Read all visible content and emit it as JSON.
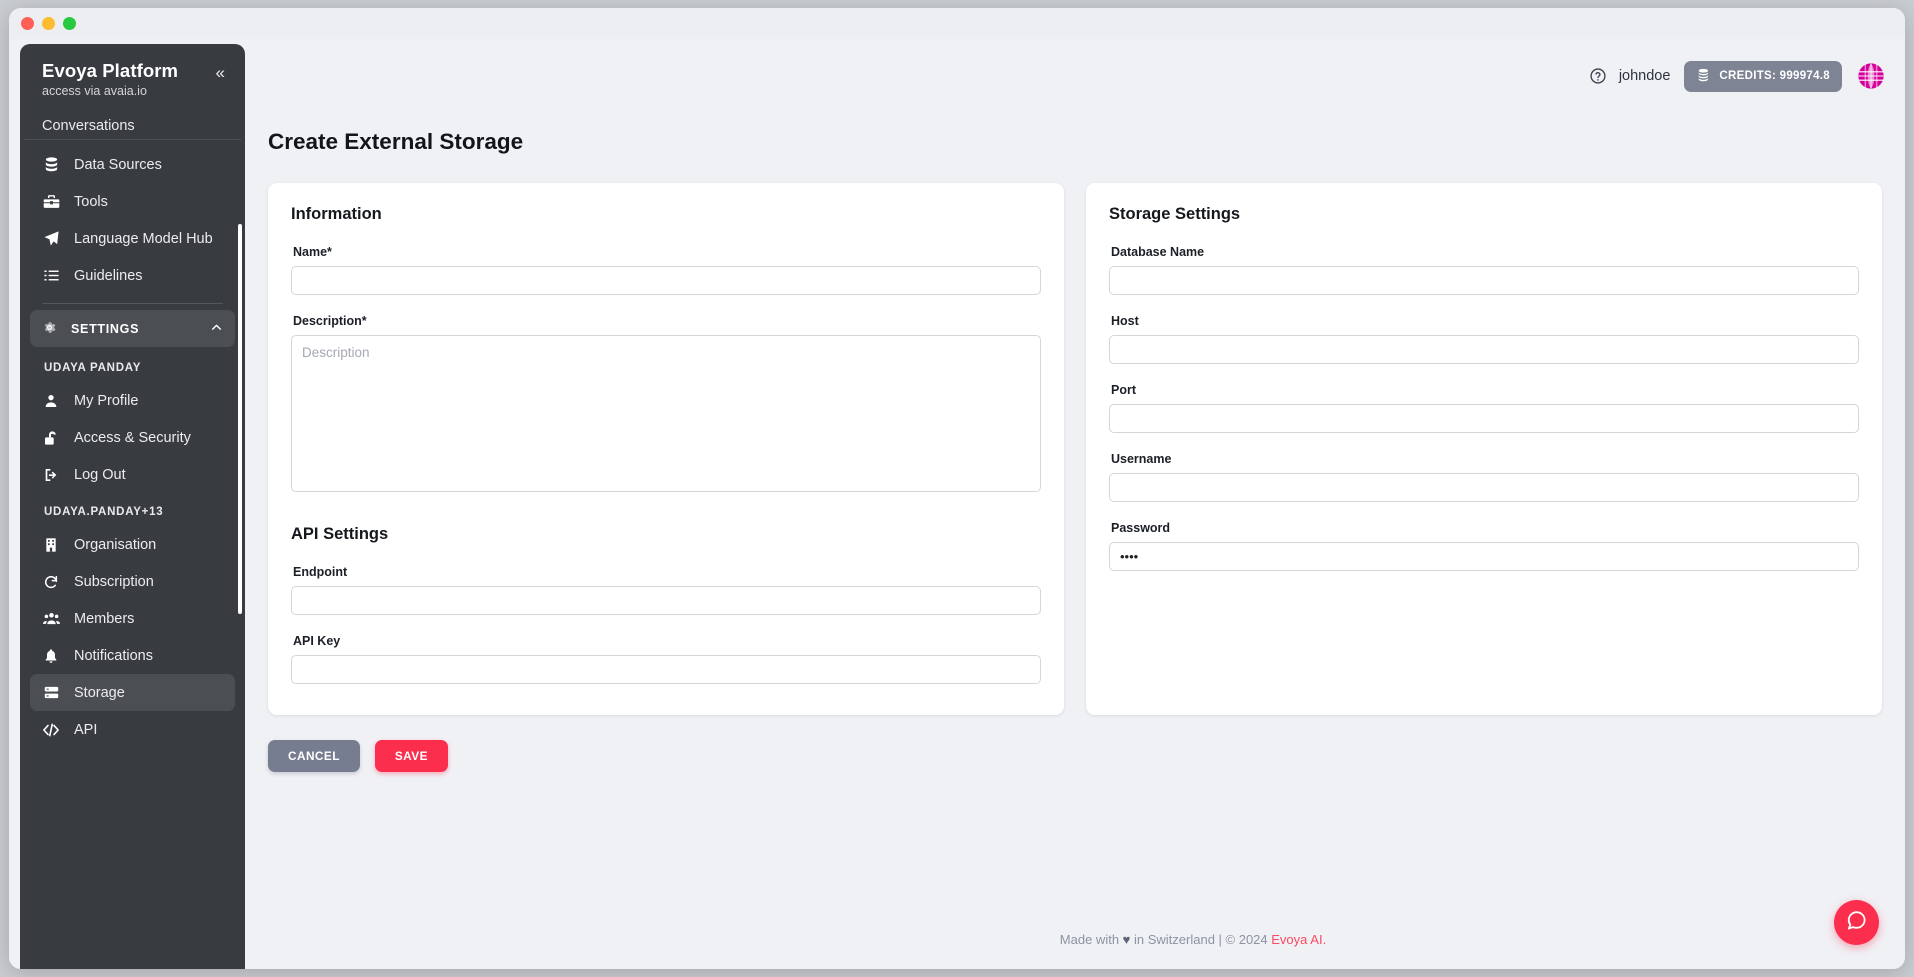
{
  "window": {
    "traffic_lights": [
      "close",
      "minimize",
      "maximize"
    ]
  },
  "sidebar": {
    "title": "Evoya Platform",
    "subtitle": "access via avaia.io",
    "collapse_icon": "chevron-double-left-icon",
    "scrolled_item_partial": "Conversations",
    "items": [
      {
        "label": "Data Sources",
        "icon": "database-icon"
      },
      {
        "label": "Tools",
        "icon": "toolbox-icon"
      },
      {
        "label": "Language Model Hub",
        "icon": "paper-plane-icon"
      },
      {
        "label": "Guidelines",
        "icon": "list-check-icon"
      }
    ],
    "settings_section": {
      "label": "SETTINGS",
      "icon": "gear-icon",
      "chevron": "chevron-up-icon",
      "expanded": true
    },
    "groups": [
      {
        "label": "UDAYA PANDAY",
        "items": [
          {
            "label": "My Profile",
            "icon": "user-icon"
          },
          {
            "label": "Access & Security",
            "icon": "lock-open-icon"
          },
          {
            "label": "Log Out",
            "icon": "logout-icon"
          }
        ]
      },
      {
        "label": "UDAYA.PANDAY+13",
        "items": [
          {
            "label": "Organisation",
            "icon": "building-icon"
          },
          {
            "label": "Subscription",
            "icon": "refresh-icon"
          },
          {
            "label": "Members",
            "icon": "users-icon"
          },
          {
            "label": "Notifications",
            "icon": "bell-icon"
          },
          {
            "label": "Storage",
            "icon": "server-icon",
            "active": true
          },
          {
            "label": "API",
            "icon": "code-icon"
          }
        ]
      }
    ]
  },
  "topbar": {
    "help_icon": "question-circle-icon",
    "username": "johndoe",
    "credits_icon": "coins-icon",
    "credits_label": "CREDITS: 999974.8",
    "avatar_name": "user-avatar-identicon"
  },
  "main": {
    "page_title": "Create External Storage",
    "information": {
      "heading": "Information",
      "name_label": "Name*",
      "name_value": "",
      "name_placeholder": "",
      "description_label": "Description*",
      "description_value": "",
      "description_placeholder": "Description"
    },
    "api_settings": {
      "heading": "API Settings",
      "endpoint_label": "Endpoint",
      "endpoint_value": "",
      "endpoint_placeholder": "",
      "api_key_label": "API Key",
      "api_key_value": "",
      "api_key_placeholder": ""
    },
    "storage_settings": {
      "heading": "Storage Settings",
      "database_name_label": "Database Name",
      "database_name_value": "",
      "host_label": "Host",
      "host_value": "",
      "port_label": "Port",
      "port_value": "",
      "username_label": "Username",
      "username_value": "",
      "password_label": "Password",
      "password_value": "••••"
    },
    "actions": {
      "cancel_label": "CANCEL",
      "save_label": "SAVE"
    }
  },
  "footer": {
    "prefix": "Made with ",
    "heart": "♥",
    "middle": " in Switzerland | © 2024 ",
    "brand": "Evoya AI."
  },
  "chat": {
    "fab_icon": "chat-bubble-icon"
  },
  "colors": {
    "sidebar_bg": "#383b40",
    "sidebar_active": "#4b4e53",
    "page_bg": "#f0f1f5",
    "card_bg": "#ffffff",
    "accent_red": "#fb2e4e",
    "cancel_gray": "#767d91",
    "credits_badge": "#7e8494",
    "avatar_magenta": "#d5009b"
  }
}
